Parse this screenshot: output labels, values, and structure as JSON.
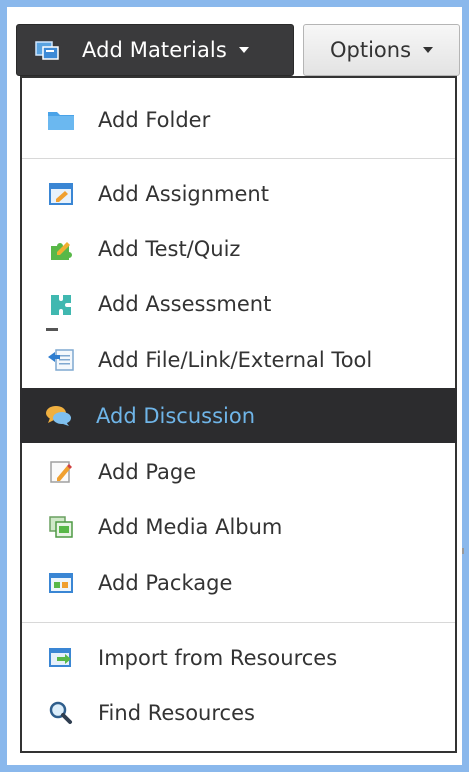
{
  "toolbar": {
    "add_materials_label": "Add Materials",
    "options_label": "Options"
  },
  "menu": {
    "items": [
      {
        "label": "Add Folder",
        "icon": "folder-icon"
      },
      {
        "label": "Add Assignment",
        "icon": "assignment-icon"
      },
      {
        "label": "Add Test/Quiz",
        "icon": "test-quiz-icon"
      },
      {
        "label": "Add Assessment",
        "icon": "assessment-icon"
      },
      {
        "label": "Add File/Link/External Tool",
        "icon": "file-link-icon"
      },
      {
        "label": "Add Discussion",
        "icon": "discussion-icon",
        "active": true
      },
      {
        "label": "Add Page",
        "icon": "page-icon"
      },
      {
        "label": "Add Media Album",
        "icon": "media-album-icon"
      },
      {
        "label": "Add Package",
        "icon": "package-icon"
      },
      {
        "label": "Import from Resources",
        "icon": "import-icon"
      },
      {
        "label": "Find Resources",
        "icon": "search-icon"
      }
    ]
  },
  "colors": {
    "background": "#8ab8ec",
    "active_bg": "#2c2c2e",
    "active_text": "#6fb5e8",
    "button_dark": "#3a3a3c"
  }
}
